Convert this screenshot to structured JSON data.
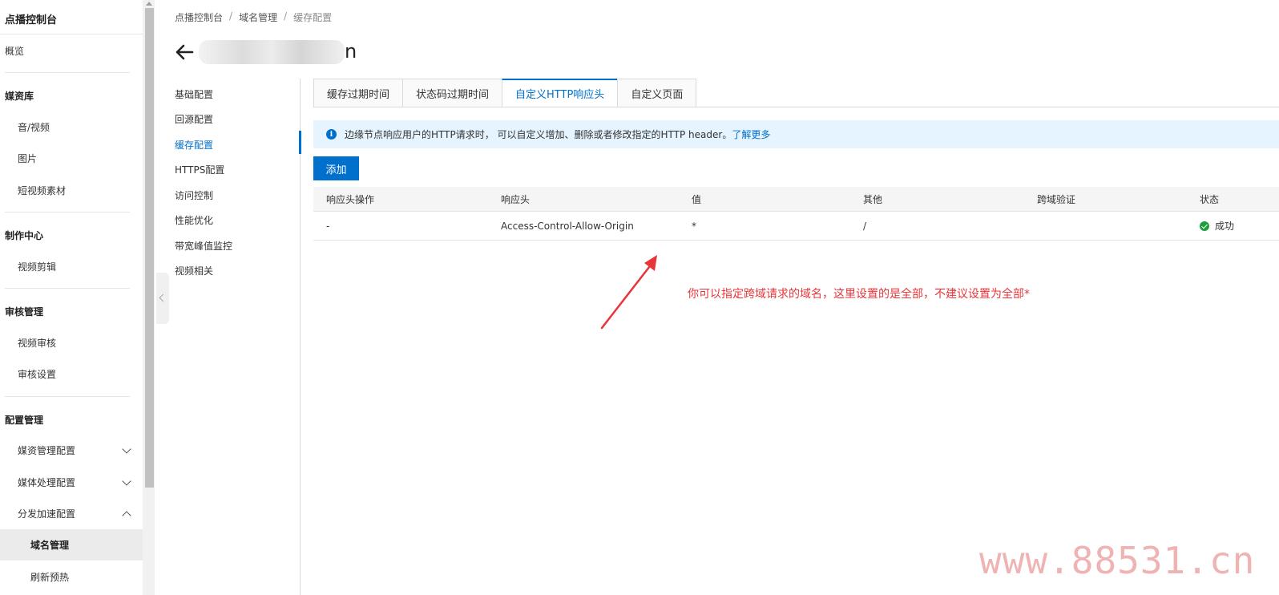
{
  "sidebar": {
    "title": "点播控制台",
    "overview": "概览",
    "groups": {
      "media": "媒资库",
      "production": "制作中心",
      "review": "审核管理",
      "config": "配置管理"
    },
    "items": {
      "audio_video": "音/视频",
      "images": "图片",
      "short_video": "短视频素材",
      "video_edit": "视频剪辑",
      "video_review": "视频审核",
      "review_settings": "审核设置",
      "media_mgmt_config": "媒资管理配置",
      "media_proc_config": "媒体处理配置",
      "distribution_config": "分发加速配置",
      "domain_mgmt": "域名管理",
      "refresh_preload": "刷新预热"
    }
  },
  "breadcrumb": {
    "item1": "点播控制台",
    "item2": "域名管理",
    "item3": "缓存配置",
    "sep": "/"
  },
  "header": {
    "domain_tail": "n"
  },
  "subnav": {
    "items": [
      "基础配置",
      "回源配置",
      "缓存配置",
      "HTTPS配置",
      "访问控制",
      "性能优化",
      "带宽峰值监控",
      "视频相关"
    ]
  },
  "tabs": {
    "items": [
      "缓存过期时间",
      "状态码过期时间",
      "自定义HTTP响应头",
      "自定义页面"
    ]
  },
  "info": {
    "text": "边缘节点响应用户的HTTP请求时， 可以自定义增加、删除或者修改指定的HTTP header。",
    "link": "了解更多",
    "icon": "info-icon"
  },
  "add_button": "添加",
  "table": {
    "headers": [
      "响应头操作",
      "响应头",
      "值",
      "其他",
      "跨域验证",
      "状态"
    ],
    "rows": [
      {
        "op": "-",
        "header": "Access-Control-Allow-Origin",
        "value": "*",
        "other": "/",
        "cors": "",
        "status": "成功"
      }
    ]
  },
  "annotation": "你可以指定跨域请求的域名，这里设置的是全部，不建议设置为全部*",
  "watermark": "www.88531.cn",
  "colors": {
    "accent": "#0070cc",
    "annotation": "#e8353a",
    "success": "#1e9e3e"
  }
}
